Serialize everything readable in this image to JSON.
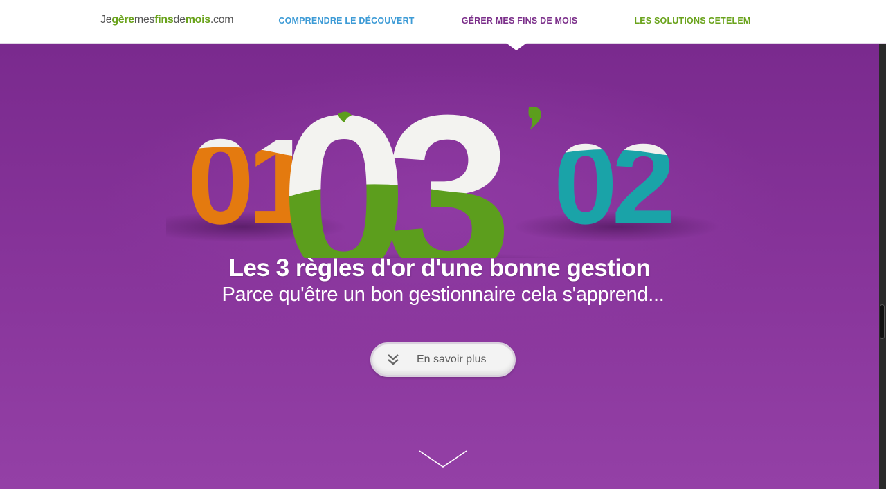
{
  "header": {
    "logo": {
      "p1": "Je",
      "p2": "gère",
      "p3": "mes",
      "p4": "fins",
      "p5": "de",
      "p6": "mois",
      "p7": ".com"
    },
    "nav": [
      {
        "label": "COMPRENDRE LE DÉCOUVERT",
        "color": "#3d9bd6"
      },
      {
        "label": "GÉRER MES FINS DE MOIS",
        "color": "#7b2f8a",
        "active": true
      },
      {
        "label": "LES SOLUTIONS CETELEM",
        "color": "#6aa31c"
      }
    ]
  },
  "hero": {
    "title": "Les 3 règles d'or d'une bonne gestion",
    "subtitle": "Parce qu'être un bon gestionnaire cela s'apprend...",
    "cta_label": "En savoir plus",
    "illustration": {
      "back_left": "01",
      "center": "03",
      "back_right": "02",
      "colors": {
        "left": "#e47a0f",
        "center": "#5c9e1d",
        "right": "#1aa3a8",
        "paper": "#f2f2ef"
      }
    }
  },
  "icons": {
    "cta": "double-chevron-down-icon",
    "scroll": "chevron-down-icon"
  }
}
